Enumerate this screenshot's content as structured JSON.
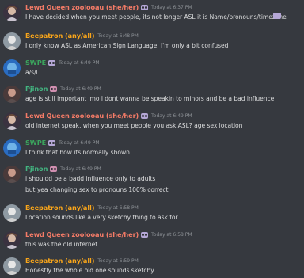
{
  "colors": {
    "background": "#36393f",
    "lewd_queen": "#f47b67",
    "beepatron": "#faa61a",
    "swpe": "#3ba55d",
    "pjinon": "#43b581",
    "timestamp": "#8e9297",
    "text": "#dcddde"
  },
  "messages": [
    {
      "author": "Lewd Queen zoolooau (she/her)",
      "timestamp": "Today at 6:37 PM",
      "lines": [
        "I have decided when you meet people, its not longer ASL it is Name/pronouns/timezone"
      ]
    },
    {
      "author": "Beepatron (any/all)",
      "timestamp": "Today at 6:48 PM",
      "lines": [
        "I only know ASL as American Sign Language. I'm only a bit confused"
      ]
    },
    {
      "author": "SWPE",
      "timestamp": "Today at 6:49 PM",
      "lines": [
        "a/s/l"
      ]
    },
    {
      "author": "Pjinon",
      "timestamp": "Today at 6:49 PM",
      "lines": [
        "age is still important imo i dont wanna be speakin to minors and be a bad influence"
      ]
    },
    {
      "author": "Lewd Queen zoolooau (she/her)",
      "timestamp": "Today at 6:49 PM",
      "lines": [
        "old internet speak, when you meet people you ask ASL? age sex location"
      ]
    },
    {
      "author": "SWPE",
      "timestamp": "Today at 6:49 PM",
      "lines": [
        "I think that how its normally shown"
      ]
    },
    {
      "author": "Pjinon",
      "timestamp": "Today at 6:49 PM",
      "lines": [
        "i shouldd be a badd influence only to adults",
        "but yea changing sex to pronouns 100% correct"
      ]
    },
    {
      "author": "Beepatron (any/all)",
      "timestamp": "Today at 6:58 PM",
      "lines": [
        "Location sounds like a very sketchy thing to ask for"
      ]
    },
    {
      "author": "Lewd Queen zoolooau (she/her)",
      "timestamp": "Today at 6:58 PM",
      "lines": [
        "this was the old internet"
      ]
    },
    {
      "author": "Beepatron (any/all)",
      "timestamp": "Today at 6:59 PM",
      "lines": [
        "Honestly the whole old one sounds sketchy"
      ]
    }
  ]
}
